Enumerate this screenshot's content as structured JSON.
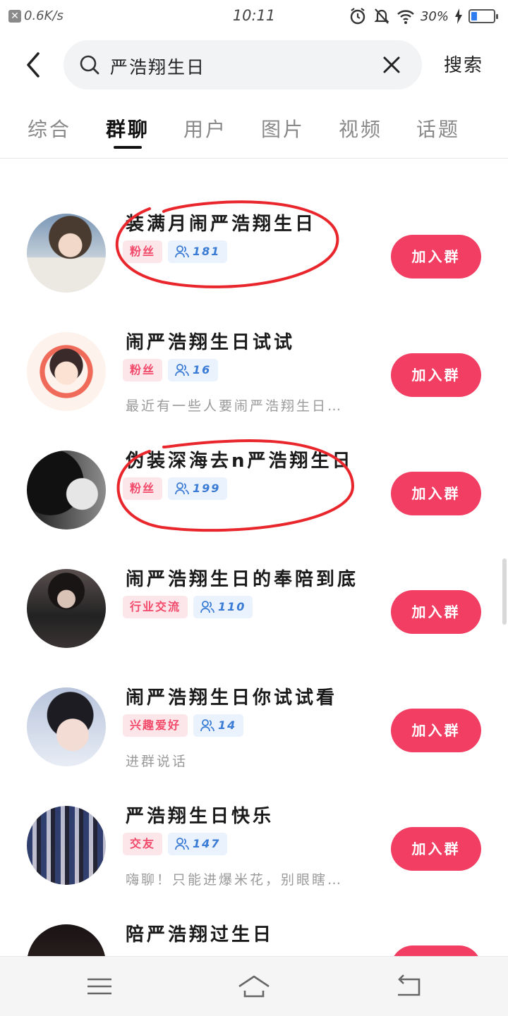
{
  "status_bar": {
    "speed": "0.6K/s",
    "time": "10:11",
    "battery": "30%"
  },
  "search": {
    "query": "严浩翔生日",
    "submit_label": "搜索"
  },
  "tabs": [
    {
      "label": "综合"
    },
    {
      "label": "群聊"
    },
    {
      "label": "用户"
    },
    {
      "label": "图片"
    },
    {
      "label": "视频"
    },
    {
      "label": "话题"
    }
  ],
  "join_label": "加入群",
  "groups": [
    {
      "name": "装满月闹严浩翔生日",
      "category": "粉丝",
      "members": "181",
      "description": ""
    },
    {
      "name": "闹严浩翔生日试试",
      "category": "粉丝",
      "members": "16",
      "description": "最近有一些人要闹严浩翔生日…"
    },
    {
      "name": "伪装深海去n严浩翔生日",
      "category": "粉丝",
      "members": "199",
      "description": ""
    },
    {
      "name": "闹严浩翔生日的奉陪到底",
      "category": "行业交流",
      "members": "110",
      "description": ""
    },
    {
      "name": "闹严浩翔生日你试试看",
      "category": "兴趣爱好",
      "members": "14",
      "description": "进群说话"
    },
    {
      "name": "严浩翔生日快乐",
      "category": "交友",
      "members": "147",
      "description": "嗨聊！只能进爆米花，别眼瞎…"
    },
    {
      "name": "陪严浩翔过生日",
      "category": "",
      "members": "",
      "description": ""
    }
  ],
  "colors": {
    "accent": "#f23e63",
    "circle": "#e8262c",
    "tag_pink": "#f24a6a",
    "tag_blue": "#3a7bd5"
  }
}
